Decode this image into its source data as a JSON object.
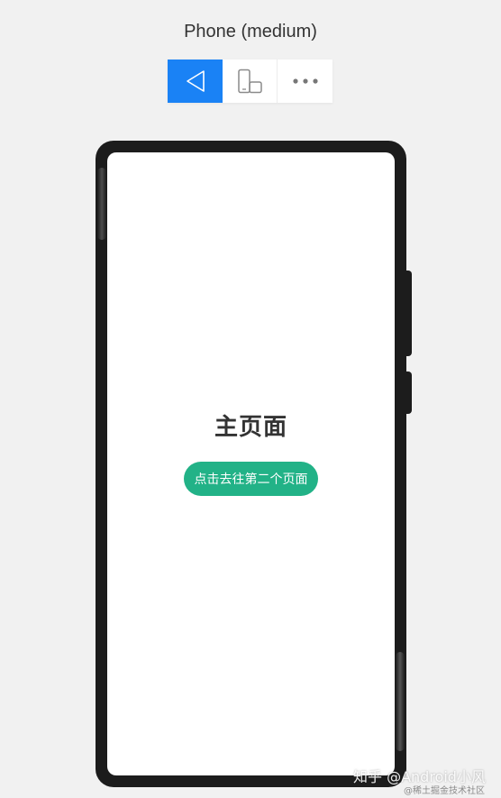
{
  "device": {
    "title": "Phone (medium)"
  },
  "toolbar": {
    "buttons": [
      {
        "icon": "back-triangle-icon",
        "active": true
      },
      {
        "icon": "device-rotate-icon",
        "active": false
      },
      {
        "icon": "more-dots-icon",
        "active": false
      }
    ],
    "active_color": "#1a82f5"
  },
  "screen": {
    "title": "主页面",
    "button_label": "点击去往第二个页面",
    "button_color": "#22b287"
  },
  "watermark": {
    "main": "知乎 @Android小风",
    "sub": "@稀土掘金技术社区"
  }
}
